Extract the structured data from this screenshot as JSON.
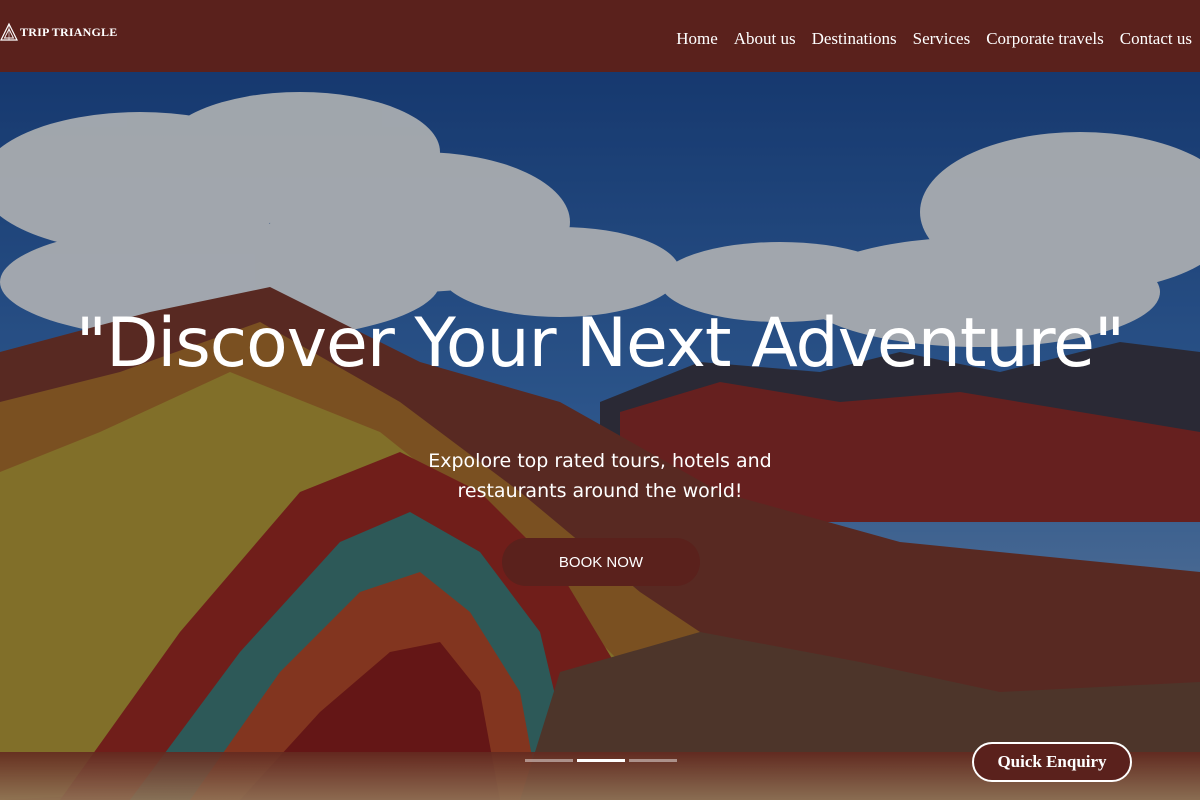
{
  "brand": {
    "name": "TRIP TRIANGLE",
    "logo_icon": "triangle-logo-icon"
  },
  "nav": {
    "items": [
      {
        "label": "Home"
      },
      {
        "label": "About us"
      },
      {
        "label": "Destinations"
      },
      {
        "label": "Services"
      },
      {
        "label": "Corporate travels"
      },
      {
        "label": "Contact us"
      }
    ]
  },
  "hero": {
    "headline": "\"Discover Your Next Adventure\"",
    "subtext": "Expolore top rated tours, hotels and restaurants around the world!",
    "cta_label": "BOOK NOW",
    "slides": 3,
    "active_slide": 2
  },
  "enquiry": {
    "label": "Quick Enquiry"
  },
  "colors": {
    "brand": "#5a211c",
    "text": "#ffffff"
  }
}
